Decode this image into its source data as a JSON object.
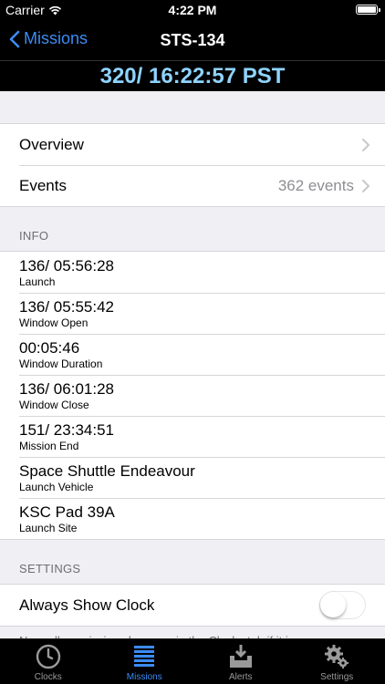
{
  "status_bar": {
    "carrier": "Carrier",
    "time": "4:22 PM"
  },
  "nav": {
    "back_label": "Missions",
    "title": "STS-134"
  },
  "clock_banner": "320/ 16:22:57 PST",
  "menu": {
    "overview_label": "Overview",
    "events_label": "Events",
    "events_count": "362 events"
  },
  "info": {
    "header": "INFO",
    "rows": [
      {
        "value": "136/ 05:56:28",
        "caption": "Launch"
      },
      {
        "value": "136/ 05:55:42",
        "caption": "Window Open"
      },
      {
        "value": "00:05:46",
        "caption": "Window Duration"
      },
      {
        "value": "136/ 06:01:28",
        "caption": "Window Close"
      },
      {
        "value": "151/ 23:34:51",
        "caption": "Mission End"
      },
      {
        "value": "Space Shuttle Endeavour",
        "caption": "Launch Vehicle"
      },
      {
        "value": "KSC Pad 39A",
        "caption": "Launch Site"
      }
    ]
  },
  "settings": {
    "header": "SETTINGS",
    "always_show_clock_label": "Always Show Clock",
    "always_show_clock_on": false,
    "note": "Normally a mission shows up in the Clocks tab if it is"
  },
  "tabs": [
    {
      "label": "Clocks",
      "icon": "clock-icon",
      "active": false
    },
    {
      "label": "Missions",
      "icon": "list-icon",
      "active": true
    },
    {
      "label": "Alerts",
      "icon": "inbox-download-icon",
      "active": false
    },
    {
      "label": "Settings",
      "icon": "gear-icon",
      "active": false
    }
  ],
  "colors": {
    "accent": "#3b8cf3",
    "clock_text": "#8fd3ff",
    "bar_bg": "#000000",
    "background": "#efeff4"
  }
}
